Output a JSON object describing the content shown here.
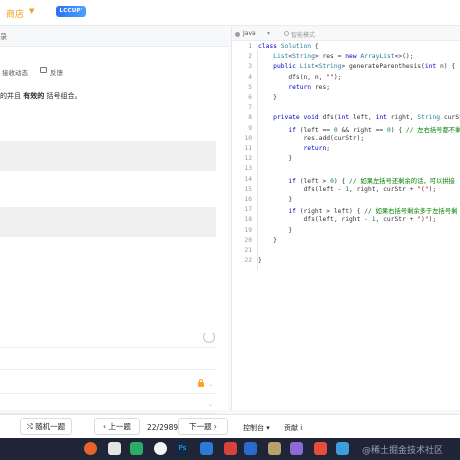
{
  "topbar": {
    "brand": "商店",
    "badge": "LCCUP' 23"
  },
  "left": {
    "header_text": "录",
    "tabs": {
      "solutions_dynamic": "接收动态",
      "feedback": "反馈"
    },
    "description": {
      "prefix": "的并且 ",
      "bold": "有效的",
      "suffix": " 括号组合。"
    }
  },
  "editor": {
    "language": "Java",
    "mode": "智能模式",
    "lines": [
      {
        "n": "1",
        "t": "class Solution {"
      },
      {
        "n": "2",
        "t": "    List<String> res = new ArrayList<>();"
      },
      {
        "n": "3",
        "t": "    public List<String> generateParenthesis(int n) {"
      },
      {
        "n": "4",
        "t": "        dfs(n, n, \"\");"
      },
      {
        "n": "5",
        "t": "        return res;"
      },
      {
        "n": "6",
        "t": "    }"
      },
      {
        "n": "7",
        "t": ""
      },
      {
        "n": "8",
        "t": "    private void dfs(int left, int right, String curStr)"
      },
      {
        "n": "9",
        "t": "        if (left == 0 && right == 0) { // 左右括号都不剩"
      },
      {
        "n": "10",
        "t": "            res.add(curStr);"
      },
      {
        "n": "11",
        "t": "            return;"
      },
      {
        "n": "12",
        "t": "        }"
      },
      {
        "n": "13",
        "t": ""
      },
      {
        "n": "14",
        "t": "        if (left > 0) { // 如果左括号还剩余的话，可以拼接"
      },
      {
        "n": "15",
        "t": "            dfs(left - 1, right, curStr + \"(\");"
      },
      {
        "n": "16",
        "t": "        }"
      },
      {
        "n": "17",
        "t": "        if (right > left) { // 如果右括号剩余多于左括号剩"
      },
      {
        "n": "18",
        "t": "            dfs(left, right - 1, curStr + \")\");"
      },
      {
        "n": "19",
        "t": "        }"
      },
      {
        "n": "20",
        "t": "    }"
      },
      {
        "n": "21",
        "t": ""
      },
      {
        "n": "22",
        "t": "}"
      }
    ]
  },
  "bottom": {
    "random": "随机一题",
    "prev": "上一题",
    "page": "22/2989",
    "next": "下一题",
    "console": "控制台",
    "contrib": "贡献 i"
  },
  "watermark": "@稀土掘金技术社区"
}
